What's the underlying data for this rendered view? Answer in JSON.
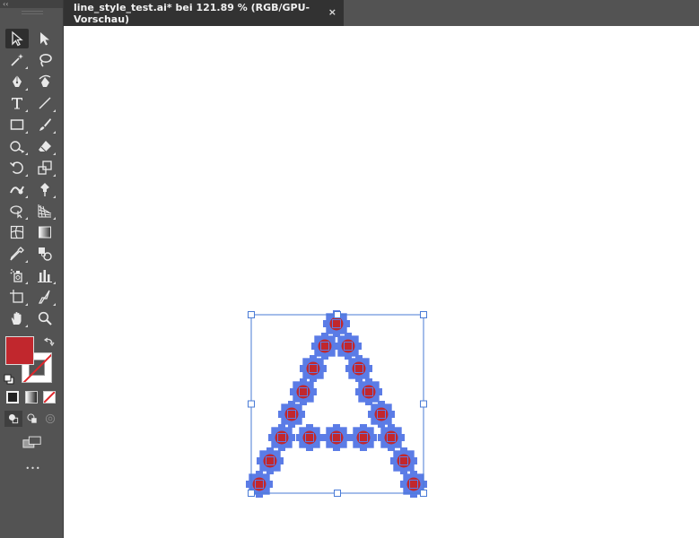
{
  "window": {
    "collapse_glyph": "‹‹"
  },
  "document_tab": {
    "title": "line_style_test.ai* bei 121.89 % (RGB/GPU-Vorschau)",
    "close_glyph": "×"
  },
  "tools": [
    {
      "name": "selection-tool-icon"
    },
    {
      "name": "direct-selection-tool-icon"
    },
    {
      "name": "magic-wand-tool-icon"
    },
    {
      "name": "lasso-tool-icon"
    },
    {
      "name": "pen-tool-icon"
    },
    {
      "name": "curvature-tool-icon"
    },
    {
      "name": "type-tool-icon"
    },
    {
      "name": "line-segment-tool-icon"
    },
    {
      "name": "rectangle-tool-icon"
    },
    {
      "name": "paintbrush-tool-icon"
    },
    {
      "name": "shaper-tool-icon"
    },
    {
      "name": "eraser-tool-icon"
    },
    {
      "name": "rotate-tool-icon"
    },
    {
      "name": "scale-tool-icon"
    },
    {
      "name": "warp-tool-icon"
    },
    {
      "name": "puppet-warp-tool-icon"
    },
    {
      "name": "shape-builder-tool-icon"
    },
    {
      "name": "perspective-grid-tool-icon"
    },
    {
      "name": "mesh-tool-icon"
    },
    {
      "name": "gradient-tool-icon"
    },
    {
      "name": "eyedropper-tool-icon"
    },
    {
      "name": "blend-tool-icon"
    },
    {
      "name": "symbol-sprayer-tool-icon"
    },
    {
      "name": "column-graph-tool-icon"
    },
    {
      "name": "artboard-tool-icon"
    },
    {
      "name": "slice-tool-icon"
    },
    {
      "name": "hand-tool-icon"
    },
    {
      "name": "zoom-tool-icon"
    }
  ],
  "colors": {
    "fill": "#c1272d",
    "stroke": "none",
    "anchor_handle": "#5b7ce6",
    "selection_box": "#4a7bd6",
    "ui_bg": "#535353",
    "tab_bg": "#323232"
  },
  "more_tools_glyph": "•••"
}
